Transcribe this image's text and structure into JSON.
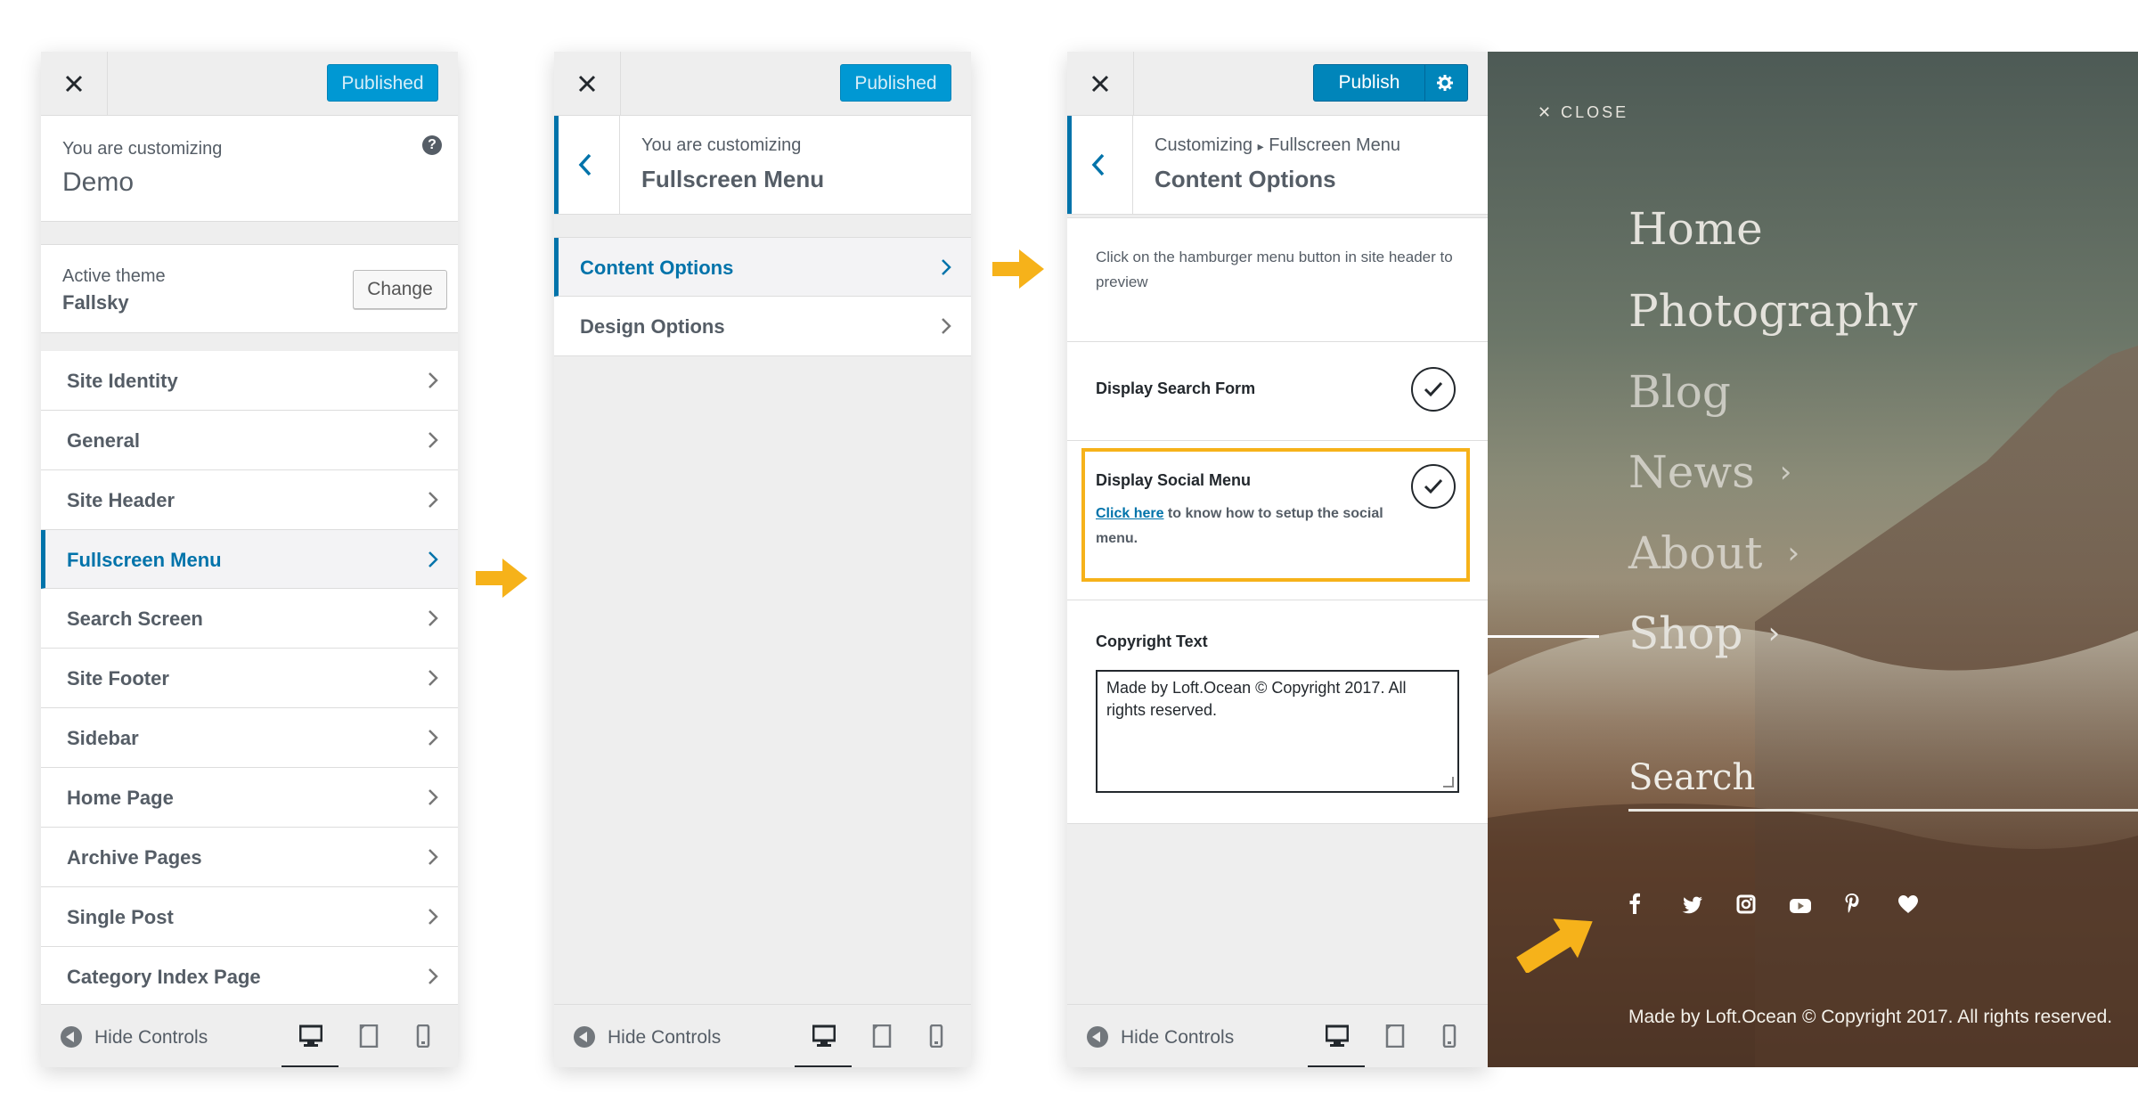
{
  "colors": {
    "accent": "#0073aa",
    "published": "#0098d3",
    "highlight": "#f6b21a"
  },
  "panel1": {
    "published_label": "Published",
    "customizing_label": "You are customizing",
    "site_name": "Demo",
    "help_glyph": "?",
    "active_theme_label": "Active theme",
    "theme_name": "Fallsky",
    "change_label": "Change",
    "nav": [
      {
        "label": "Site Identity"
      },
      {
        "label": "General"
      },
      {
        "label": "Site Header"
      },
      {
        "label": "Fullscreen Menu",
        "active": true
      },
      {
        "label": "Search Screen"
      },
      {
        "label": "Site Footer"
      },
      {
        "label": "Sidebar"
      },
      {
        "label": "Home Page"
      },
      {
        "label": "Archive Pages"
      },
      {
        "label": "Single Post"
      },
      {
        "label": "Category Index Page"
      }
    ]
  },
  "panel2": {
    "published_label": "Published",
    "customizing_label": "You are customizing",
    "section_title": "Fullscreen Menu",
    "nav": [
      {
        "label": "Content Options",
        "active": true
      },
      {
        "label": "Design Options"
      }
    ]
  },
  "panel3": {
    "publish_label": "Publish",
    "breadcrumb_root": "Customizing",
    "breadcrumb_sep": "▸",
    "breadcrumb_parent": "Fullscreen Menu",
    "section_title": "Content Options",
    "description": "Click on the hamburger menu button in site header to preview",
    "display_search_label": "Display Search Form",
    "display_social_label": "Display Social Menu",
    "social_link_text": "Click here",
    "social_note_text": " to know how to setup the social menu.",
    "copyright_label": "Copyright Text",
    "copyright_value": "Made by Loft.Ocean © Copyright 2017. All rights reserved."
  },
  "footer": {
    "hide_controls_label": "Hide Controls"
  },
  "preview": {
    "close_label": "✕ CLOSE",
    "menu": [
      {
        "label": "Home"
      },
      {
        "label": "Photography"
      },
      {
        "label": "Blog"
      },
      {
        "label": "News",
        "submenu": "›"
      },
      {
        "label": "About",
        "submenu": "›"
      },
      {
        "label": "Shop",
        "submenu": "›"
      }
    ],
    "search_label": "Search",
    "social": [
      "f",
      "t",
      "ig",
      "yt",
      "p",
      "♥"
    ],
    "copyright": "Made by Loft.Ocean © Copyright 2017. All rights reserved."
  }
}
